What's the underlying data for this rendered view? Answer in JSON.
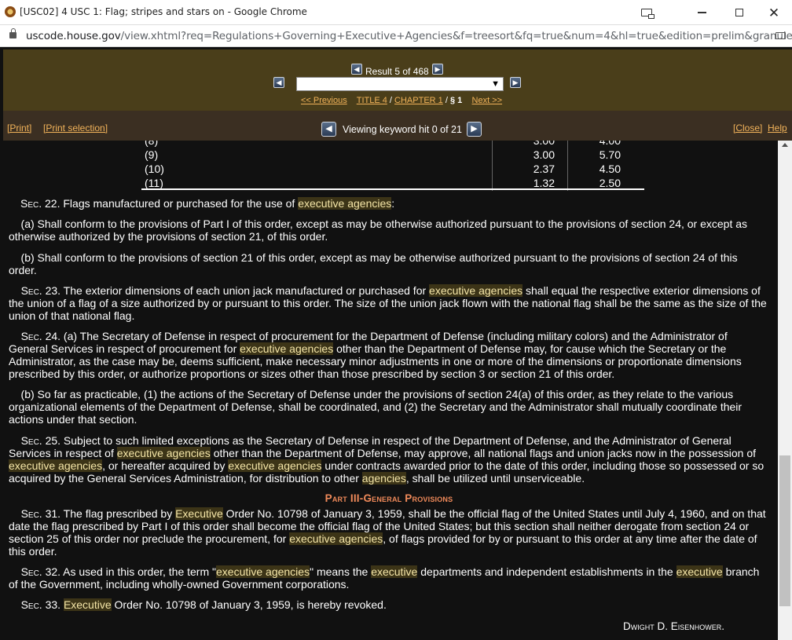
{
  "window": {
    "title": "[USC02] 4 USC 1: Flag; stripes and stars on - Google Chrome"
  },
  "address": {
    "host": "uscode.house.gov",
    "path": "/view.xhtml?req=Regulations+Governing+Executive+Agencies&f=treesort&fq=true&num=4&hl=true&edition=prelim&granuleId=..."
  },
  "nav": {
    "result_text": "Result 5 of 468",
    "prev_label": "<< Previous",
    "title_link": "TITLE 4",
    "chapter_link": "CHAPTER 1",
    "section_text": "§ 1",
    "next_label": "Next >>",
    "slash": "/"
  },
  "printbar": {
    "print": "[Print]",
    "print_selection": "[Print selection]",
    "viewing": "Viewing keyword hit 0 of 21",
    "close": "[Close]",
    "help": "Help"
  },
  "table": {
    "rows": [
      {
        "label": "(8)",
        "a": "3.00",
        "b": "4.00"
      },
      {
        "label": "(9)",
        "a": "3.00",
        "b": "5.70"
      },
      {
        "label": "(10)",
        "a": "2.37",
        "b": "4.50"
      },
      {
        "label": "(11)",
        "a": "1.32",
        "b": "2.50"
      }
    ]
  },
  "content": {
    "part_heading": "Part III-General Provisions",
    "signature": "Dwight D. Eisenhower."
  },
  "colors": {
    "nav_bg": "#4a3e1a",
    "printbar_bg": "#3b2f22",
    "link": "#f2b35a",
    "heading": "#f08a5a",
    "highlight": "#3c3417"
  }
}
